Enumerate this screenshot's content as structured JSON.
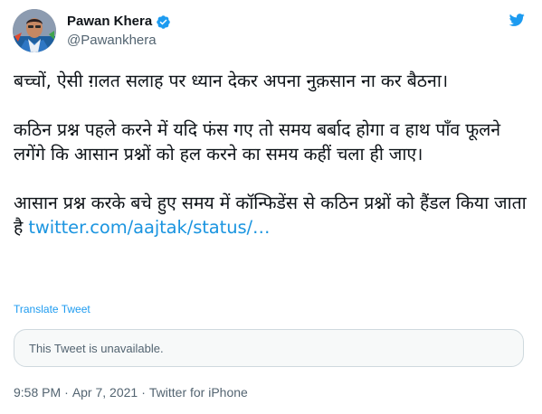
{
  "author": {
    "name": "Pawan Khera",
    "handle": "@Pawankhera",
    "verified": true
  },
  "tweet": {
    "paragraphs": [
      "बच्चों, ऐसी ग़लत सलाह पर ध्यान देकर अपना नुक़सान ना कर बैठना।",
      "कठिन प्रश्न पहले करने में यदि फंस गए तो समय बर्बाद होगा व हाथ पाँव फूलने लगेंगे कि आसान प्रश्नों को हल करने का समय कहीं चला ही जाए।",
      "आसान प्रश्न करके बचे हुए समय में कॉन्फिडेंस से कठिन प्रश्नों को हैंडल किया जाता है"
    ],
    "link_text": "twitter.com/aajtak/status/…",
    "translate_label": "Translate Tweet",
    "quoted_unavailable": "This Tweet is unavailable.",
    "time": "9:58 PM",
    "separator": "·",
    "date": "Apr 7, 2021",
    "source": "Twitter for iPhone"
  },
  "icons": {
    "verified": "verified-badge-icon",
    "more": "twitter-logo-icon"
  },
  "colors": {
    "link": "#1b95e0",
    "secondary": "#536471",
    "verified": "#1d9bf0"
  }
}
